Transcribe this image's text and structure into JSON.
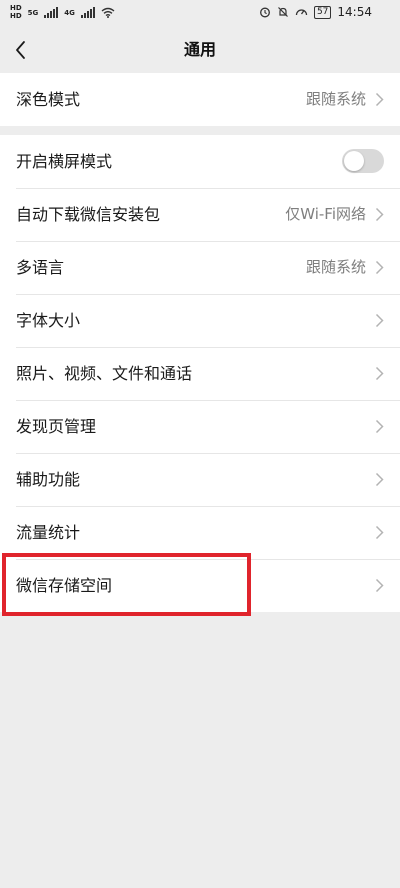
{
  "status_bar": {
    "hd1": "HD",
    "hd2": "HD",
    "net1": "5G",
    "net2": "4G",
    "battery": "57",
    "time": "14:54"
  },
  "header": {
    "title": "通用"
  },
  "settings": {
    "dark_mode": {
      "label": "深色模式",
      "value": "跟随系统"
    },
    "landscape": {
      "label": "开启横屏模式",
      "toggle_on": false
    },
    "auto_download": {
      "label": "自动下载微信安装包",
      "value": "仅Wi-Fi网络"
    },
    "language": {
      "label": "多语言",
      "value": "跟随系统"
    },
    "font_size": {
      "label": "字体大小"
    },
    "media": {
      "label": "照片、视频、文件和通话"
    },
    "discover": {
      "label": "发现页管理"
    },
    "accessibility": {
      "label": "辅助功能"
    },
    "traffic": {
      "label": "流量统计"
    },
    "storage": {
      "label": "微信存储空间"
    }
  },
  "colors": {
    "background": "#ededed",
    "highlight": "#e0242c",
    "value_text": "#7f7f7f"
  }
}
